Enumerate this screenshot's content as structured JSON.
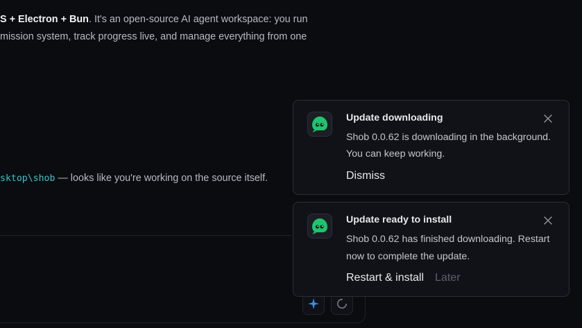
{
  "chat": {
    "line1_strong": "S + Electron + Bun",
    "line1_rest": ". It's an open-source AI agent workspace: you run",
    "line2": "mission system, track progress live, and manage everything from one",
    "line3_path": "sktop\\shob",
    "line3_rest": " — looks like you're working on the source itself."
  },
  "toasts": [
    {
      "title": "Update downloading",
      "body": "Shob 0.0.62 is downloading in the background. You can keep working.",
      "primary": "Dismiss",
      "secondary": ""
    },
    {
      "title": "Update ready to install",
      "body": "Shob 0.0.62 has finished downloading. Restart now to complete the update.",
      "primary": "Restart & install",
      "secondary": "Later"
    }
  ],
  "composer": {
    "tools": [
      "sparkle-icon",
      "loop-icon"
    ]
  },
  "colors": {
    "background": "#0b0c10",
    "toast_bg": "#101217",
    "accent_mono": "#3fc1c9",
    "brand_green": "#1ec46e",
    "sparkle_blue": "#3b8fe8"
  }
}
